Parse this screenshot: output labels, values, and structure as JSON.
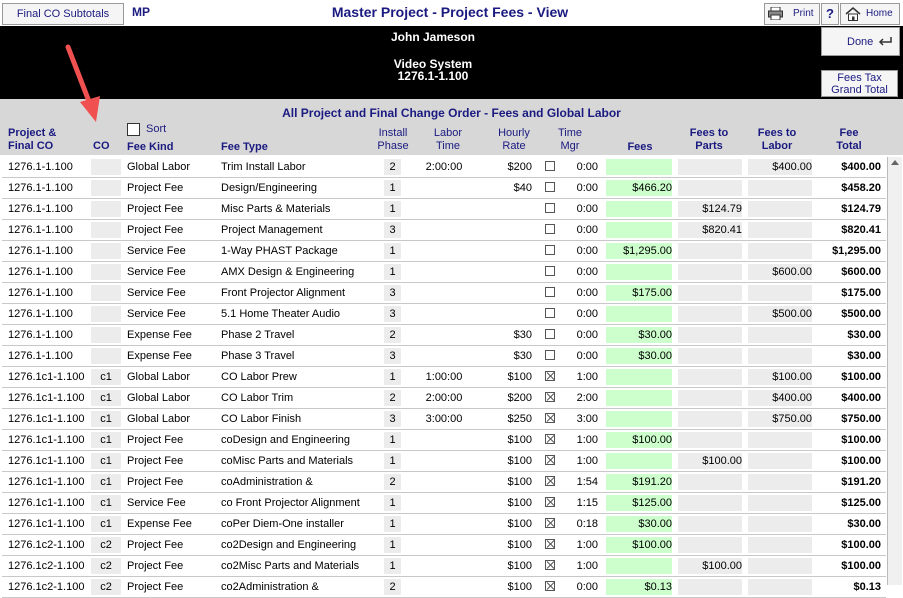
{
  "toolbar": {
    "subtotals_label": "Final CO Subtotals",
    "mp_label": "MP",
    "title": "Master Project - Project Fees - View",
    "print_label": "Print",
    "help_label": "?",
    "home_label": "Home",
    "done_label": "Done",
    "fees_tax_line1": "Fees Tax",
    "fees_tax_line2": "Grand Total"
  },
  "header": {
    "client": "John Jameson",
    "system": "Video System",
    "project_number": "1276.1-1.100"
  },
  "section": {
    "title": "All Project and Final Change Order - Fees and Global Labor",
    "sort_label": "Sort"
  },
  "columns": {
    "project_line1": "Project &",
    "project_line2": "Final CO",
    "co": "CO",
    "fee_kind": "Fee Kind",
    "fee_type": "Fee Type",
    "install_line1": "Install",
    "install_line2": "Phase",
    "labor_line1": "Labor",
    "labor_line2": "Time",
    "hourly_line1": "Hourly",
    "hourly_line2": "Rate",
    "timemgr_line1": "Time",
    "timemgr_line2": "Mgr",
    "fees": "Fees",
    "fees_parts_line1": "Fees to",
    "fees_parts_line2": "Parts",
    "fees_labor_line1": "Fees to",
    "fees_labor_line2": "Labor",
    "fee_total_line1": "Fee",
    "fee_total_line2": "Total"
  },
  "rows": [
    {
      "project": "1276.1-1.100",
      "co": "",
      "kind": "Global Labor",
      "type": "Trim Install Labor",
      "phase": "2",
      "labor": "2:00:00",
      "rate": "$200",
      "checked": false,
      "mgr": "0:00",
      "fees": "",
      "parts": "",
      "labor_fee": "$400.00",
      "total": "$400.00"
    },
    {
      "project": "1276.1-1.100",
      "co": "",
      "kind": "Project Fee",
      "type": "Design/Engineering",
      "phase": "1",
      "labor": "",
      "rate": "$40",
      "checked": false,
      "mgr": "0:00",
      "fees": "$466.20",
      "parts": "",
      "labor_fee": "",
      "total": "$458.20"
    },
    {
      "project": "1276.1-1.100",
      "co": "",
      "kind": "Project Fee",
      "type": "Misc Parts & Materials",
      "phase": "1",
      "labor": "",
      "rate": "",
      "checked": false,
      "mgr": "0:00",
      "fees": "",
      "parts": "$124.79",
      "labor_fee": "",
      "total": "$124.79"
    },
    {
      "project": "1276.1-1.100",
      "co": "",
      "kind": "Project Fee",
      "type": "Project Management",
      "phase": "3",
      "labor": "",
      "rate": "",
      "checked": false,
      "mgr": "0:00",
      "fees": "",
      "parts": "$820.41",
      "labor_fee": "",
      "total": "$820.41"
    },
    {
      "project": "1276.1-1.100",
      "co": "",
      "kind": "Service Fee",
      "type": "1-Way PHAST Package",
      "phase": "1",
      "labor": "",
      "rate": "",
      "checked": false,
      "mgr": "0:00",
      "fees": "$1,295.00",
      "parts": "",
      "labor_fee": "",
      "total": "$1,295.00"
    },
    {
      "project": "1276.1-1.100",
      "co": "",
      "kind": "Service Fee",
      "type": "AMX Design & Engineering",
      "phase": "1",
      "labor": "",
      "rate": "",
      "checked": false,
      "mgr": "0:00",
      "fees": "",
      "parts": "",
      "labor_fee": "$600.00",
      "total": "$600.00"
    },
    {
      "project": "1276.1-1.100",
      "co": "",
      "kind": "Service Fee",
      "type": "Front Projector Alignment",
      "phase": "3",
      "labor": "",
      "rate": "",
      "checked": false,
      "mgr": "0:00",
      "fees": "$175.00",
      "parts": "",
      "labor_fee": "",
      "total": "$175.00"
    },
    {
      "project": "1276.1-1.100",
      "co": "",
      "kind": "Service Fee",
      "type": "5.1 Home Theater Audio",
      "phase": "3",
      "labor": "",
      "rate": "",
      "checked": false,
      "mgr": "0:00",
      "fees": "",
      "parts": "",
      "labor_fee": "$500.00",
      "total": "$500.00"
    },
    {
      "project": "1276.1-1.100",
      "co": "",
      "kind": "Expense Fee",
      "type": "Phase 2 Travel",
      "phase": "2",
      "labor": "",
      "rate": "$30",
      "checked": false,
      "mgr": "0:00",
      "fees": "$30.00",
      "parts": "",
      "labor_fee": "",
      "total": "$30.00"
    },
    {
      "project": "1276.1-1.100",
      "co": "",
      "kind": "Expense Fee",
      "type": "Phase 3 Travel",
      "phase": "3",
      "labor": "",
      "rate": "$30",
      "checked": false,
      "mgr": "0:00",
      "fees": "$30.00",
      "parts": "",
      "labor_fee": "",
      "total": "$30.00"
    },
    {
      "project": "1276.1c1-1.100",
      "co": "c1",
      "kind": "Global Labor",
      "type": "CO Labor Prew",
      "phase": "1",
      "labor": "1:00:00",
      "rate": "$100",
      "checked": true,
      "mgr": "1:00",
      "fees": "",
      "parts": "",
      "labor_fee": "$100.00",
      "total": "$100.00"
    },
    {
      "project": "1276.1c1-1.100",
      "co": "c1",
      "kind": "Global Labor",
      "type": "CO Labor Trim",
      "phase": "2",
      "labor": "2:00:00",
      "rate": "$200",
      "checked": true,
      "mgr": "2:00",
      "fees": "",
      "parts": "",
      "labor_fee": "$400.00",
      "total": "$400.00"
    },
    {
      "project": "1276.1c1-1.100",
      "co": "c1",
      "kind": "Global Labor",
      "type": "CO Labor Finish",
      "phase": "3",
      "labor": "3:00:00",
      "rate": "$250",
      "checked": true,
      "mgr": "3:00",
      "fees": "",
      "parts": "",
      "labor_fee": "$750.00",
      "total": "$750.00"
    },
    {
      "project": "1276.1c1-1.100",
      "co": "c1",
      "kind": "Project Fee",
      "type": "coDesign and Engineering",
      "phase": "1",
      "labor": "",
      "rate": "$100",
      "checked": true,
      "mgr": "1:00",
      "fees": "$100.00",
      "parts": "",
      "labor_fee": "",
      "total": "$100.00"
    },
    {
      "project": "1276.1c1-1.100",
      "co": "c1",
      "kind": "Project Fee",
      "type": "coMisc Parts and Materials",
      "phase": "1",
      "labor": "",
      "rate": "$100",
      "checked": true,
      "mgr": "1:00",
      "fees": "",
      "parts": "$100.00",
      "labor_fee": "",
      "total": "$100.00"
    },
    {
      "project": "1276.1c1-1.100",
      "co": "c1",
      "kind": "Project Fee",
      "type": "coAdministration &",
      "phase": "2",
      "labor": "",
      "rate": "$100",
      "checked": true,
      "mgr": "1:54",
      "fees": "$191.20",
      "parts": "",
      "labor_fee": "",
      "total": "$191.20"
    },
    {
      "project": "1276.1c1-1.100",
      "co": "c1",
      "kind": "Service Fee",
      "type": "co Front Projector Alignment",
      "phase": "1",
      "labor": "",
      "rate": "$100",
      "checked": true,
      "mgr": "1:15",
      "fees": "$125.00",
      "parts": "",
      "labor_fee": "",
      "total": "$125.00"
    },
    {
      "project": "1276.1c1-1.100",
      "co": "c1",
      "kind": "Expense Fee",
      "type": "coPer Diem-One installer",
      "phase": "1",
      "labor": "",
      "rate": "$100",
      "checked": true,
      "mgr": "0:18",
      "fees": "$30.00",
      "parts": "",
      "labor_fee": "",
      "total": "$30.00"
    },
    {
      "project": "1276.1c2-1.100",
      "co": "c2",
      "kind": "Project Fee",
      "type": "co2Design and Engineering",
      "phase": "1",
      "labor": "",
      "rate": "$100",
      "checked": true,
      "mgr": "1:00",
      "fees": "$100.00",
      "parts": "",
      "labor_fee": "",
      "total": "$100.00"
    },
    {
      "project": "1276.1c2-1.100",
      "co": "c2",
      "kind": "Project Fee",
      "type": "co2Misc Parts and Materials",
      "phase": "1",
      "labor": "",
      "rate": "$100",
      "checked": true,
      "mgr": "1:00",
      "fees": "",
      "parts": "$100.00",
      "labor_fee": "",
      "total": "$100.00"
    },
    {
      "project": "1276.1c2-1.100",
      "co": "c2",
      "kind": "Project Fee",
      "type": "co2Administration &",
      "phase": "2",
      "labor": "",
      "rate": "$100",
      "checked": true,
      "mgr": "0:00",
      "fees": "$0.13",
      "parts": "",
      "labor_fee": "",
      "total": "$0.13"
    }
  ],
  "colors": {
    "accent": "#1a1a80",
    "green_cell": "#ccffcc",
    "gray_cell": "#ececec",
    "annotation_arrow": "#f05050"
  }
}
